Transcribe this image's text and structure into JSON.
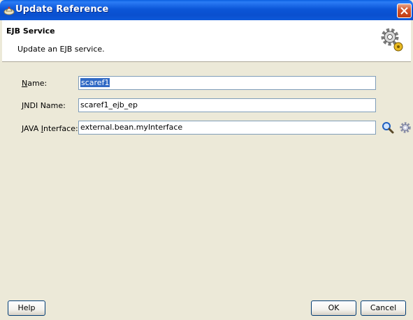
{
  "window": {
    "title": "Update Reference"
  },
  "header": {
    "title": "EJB Service",
    "description": "Update an EJB service.",
    "icon": "gear-wizard-icon"
  },
  "form": {
    "name": {
      "label_mnemonic": "N",
      "label_rest": "ame:",
      "value": "scaref1"
    },
    "jndi": {
      "label_mnemonic": "J",
      "label_rest": "NDI Name:",
      "value": "scaref1_ejb_ep"
    },
    "interface": {
      "label_pre": "JAVA ",
      "label_mnemonic": "I",
      "label_rest": "nterface:",
      "value": "external.bean.myInterface"
    }
  },
  "icons": {
    "browse": "magnifier-icon",
    "settings": "gear-icon"
  },
  "buttons": {
    "help": "Help",
    "ok": "OK",
    "cancel": "Cancel"
  },
  "colors": {
    "titlebar": "#0a4fcf",
    "selection": "#316ac5",
    "dialog": "#ece9d8"
  }
}
